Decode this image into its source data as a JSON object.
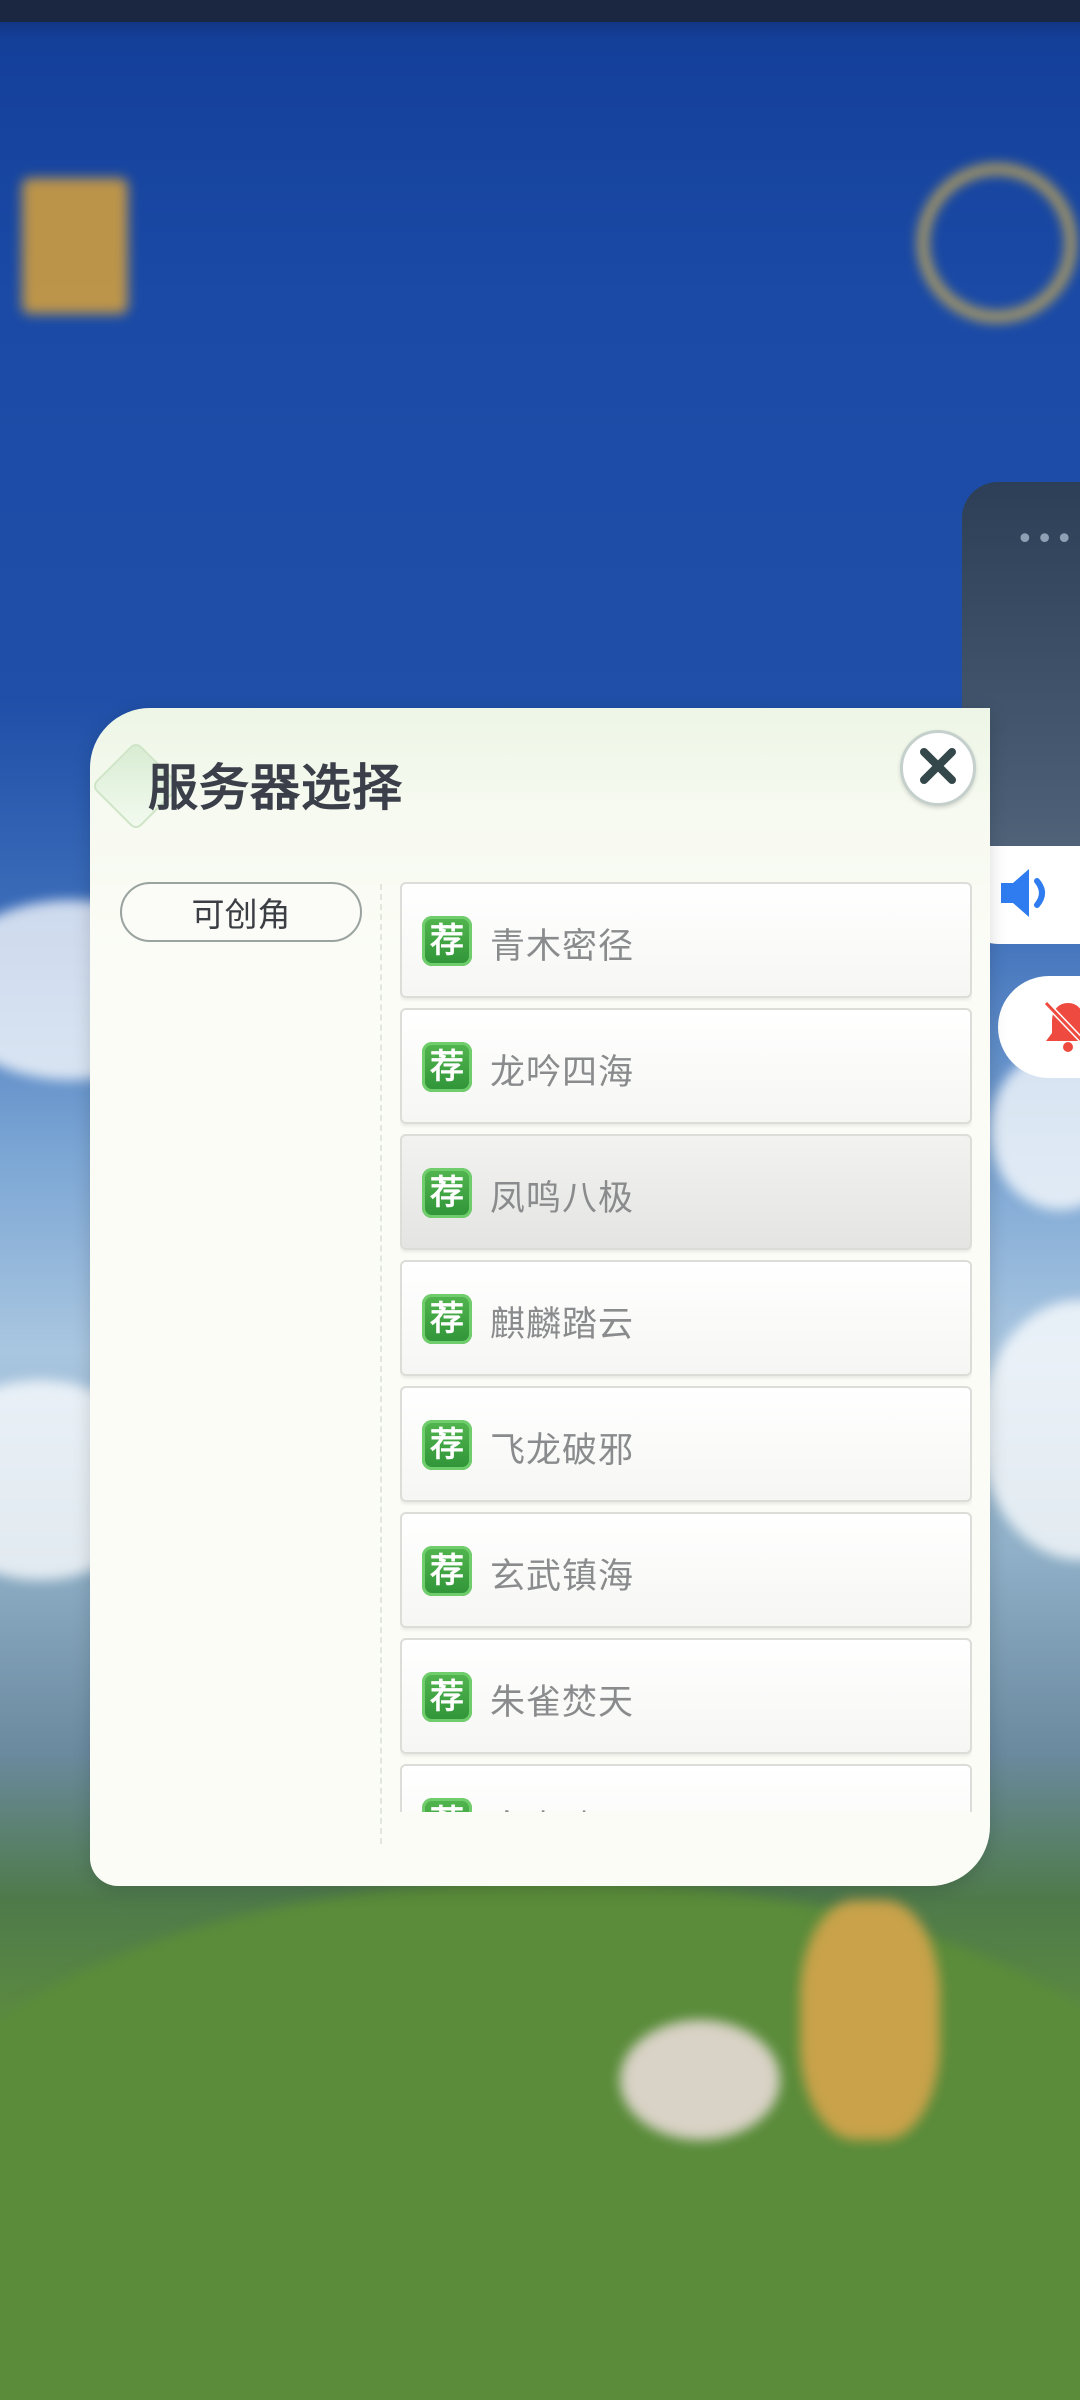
{
  "dialog": {
    "title": "服务器选择",
    "category_tab": "可创角",
    "recommend_badge": "荐",
    "servers": [
      {
        "name": "青木密径",
        "selected": false
      },
      {
        "name": "龙吟四海",
        "selected": false
      },
      {
        "name": "凤鸣八极",
        "selected": true
      },
      {
        "name": "麒麟踏云",
        "selected": false
      },
      {
        "name": "飞龙破邪",
        "selected": false
      },
      {
        "name": "玄武镇海",
        "selected": false
      },
      {
        "name": "朱雀焚天",
        "selected": false
      },
      {
        "name": "白虎啸月",
        "selected": false
      }
    ]
  },
  "icons": {
    "close": "close-icon",
    "volume": "volume-icon",
    "mute": "bell-muted-icon",
    "more": "more-dots-icon"
  },
  "colors": {
    "badge_green": "#3aa542",
    "volume_blue": "#2f7cf0",
    "mute_red": "#ef4a3f"
  }
}
